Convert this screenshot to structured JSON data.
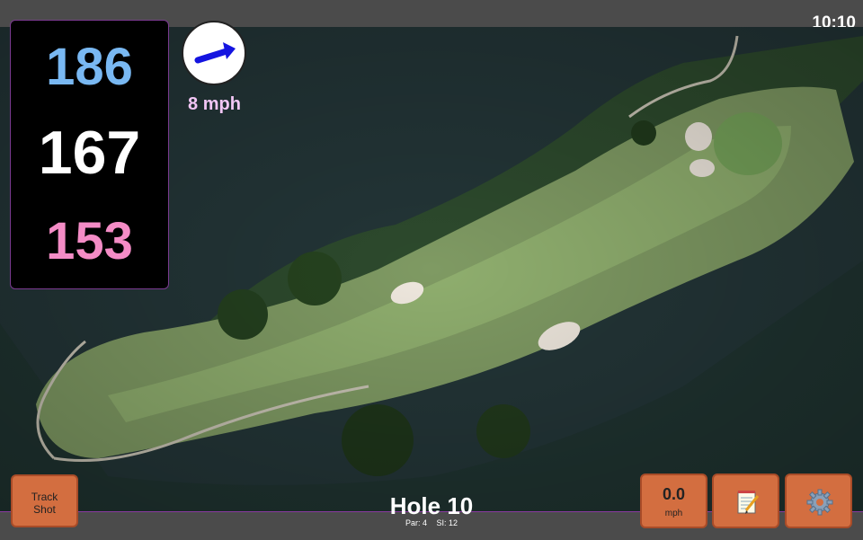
{
  "status_bar": {
    "time": "10:10"
  },
  "distances": {
    "back": "186",
    "center": "167",
    "front": "153"
  },
  "wind": {
    "speed_label": "8 mph",
    "direction_icon": "arrow-icon"
  },
  "buttons": {
    "track_shot_line1": "Track",
    "track_shot_line2": "Shot",
    "wind_value": "0.0",
    "wind_unit": "mph",
    "notes_icon": "notepad-icon",
    "settings_icon": "gear-icon"
  },
  "hole": {
    "title": "Hole 10",
    "par_label": "Par: 4",
    "si_label": "SI: 12"
  },
  "colors": {
    "back_distance": "#79b8f2",
    "center_distance": "#ffffff",
    "front_distance": "#f48cc6",
    "button": "#d36e40",
    "accent_border": "#8a3aa0"
  }
}
